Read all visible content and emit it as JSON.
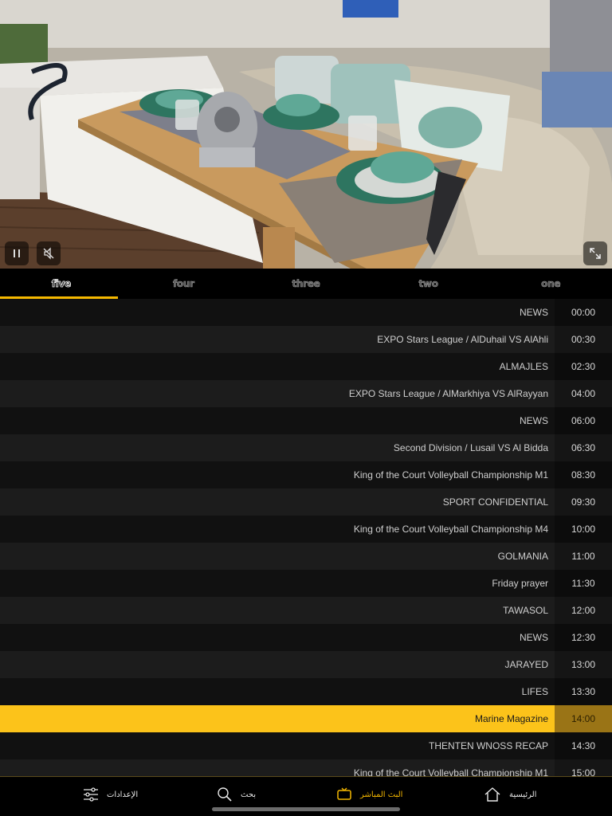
{
  "video": {
    "controls": {
      "play_pause_icon": "pause-icon",
      "mute_icon": "muted-speaker-icon",
      "fullscreen_icon": "expand-icon"
    }
  },
  "tabs": [
    {
      "label": "five",
      "active": true
    },
    {
      "label": "four",
      "active": false
    },
    {
      "label": "three",
      "active": false
    },
    {
      "label": "two",
      "active": false
    },
    {
      "label": "one",
      "active": false
    }
  ],
  "schedule": [
    {
      "time": "00:00",
      "title": "NEWS"
    },
    {
      "time": "00:30",
      "title": "EXPO Stars League /  AlDuhail VS AlAhli"
    },
    {
      "time": "02:30",
      "title": "ALMAJLES"
    },
    {
      "time": "04:00",
      "title": "EXPO Stars League /  AlMarkhiya VS AlRayyan"
    },
    {
      "time": "06:00",
      "title": "NEWS"
    },
    {
      "time": "06:30",
      "title": "Second Division / Lusail VS Al Bidda"
    },
    {
      "time": "08:30",
      "title": "King of the Court Volleyball Championship M1"
    },
    {
      "time": "09:30",
      "title": "SPORT CONFIDENTIAL"
    },
    {
      "time": "10:00",
      "title": "King of the Court Volleyball Championship M4"
    },
    {
      "time": "11:00",
      "title": "GOLMANIA"
    },
    {
      "time": "11:30",
      "title": "Friday prayer"
    },
    {
      "time": "12:00",
      "title": "TAWASOL"
    },
    {
      "time": "12:30",
      "title": "NEWS"
    },
    {
      "time": "13:00",
      "title": "JARAYED"
    },
    {
      "time": "13:30",
      "title": "LIFES"
    },
    {
      "time": "14:00",
      "title": "Marine Magazine",
      "current": true
    },
    {
      "time": "14:30",
      "title": "THENTEN WNOSS RECAP"
    },
    {
      "time": "15:00",
      "title": "King of the Court Volleyball Championship M1"
    }
  ],
  "bottom_nav": {
    "settings": {
      "label": "الإعدادات",
      "icon": "sliders-icon"
    },
    "search": {
      "label": "بحث",
      "icon": "search-icon"
    },
    "live": {
      "label": "البث المباشر",
      "icon": "tv-icon",
      "active": true
    },
    "home": {
      "label": "الرئيسية",
      "icon": "home-icon"
    }
  },
  "colors": {
    "accent": "#f5b800",
    "current_row": "#fcc31a",
    "background": "#000000"
  }
}
